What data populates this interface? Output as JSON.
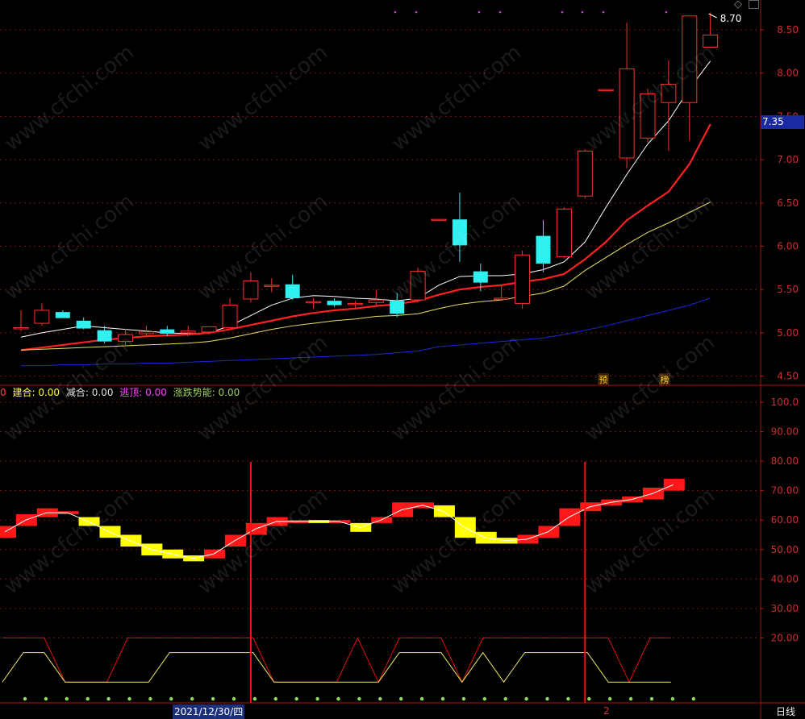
{
  "chart_data": [
    {
      "type": "candlestick",
      "period": "日线",
      "ylim": [
        4.45,
        8.75
      ],
      "y_ticks": [
        "8.50",
        "8.00",
        "7.50",
        "7.00",
        "6.50",
        "6.00",
        "5.50",
        "5.00",
        "4.50"
      ],
      "current_price": "7.35",
      "high_label": "8.70",
      "annotations": [
        "预",
        "榜"
      ],
      "candles": [
        {
          "o": 5.06,
          "h": 5.26,
          "l": 5.02,
          "c": 5.06
        },
        {
          "o": 5.11,
          "h": 5.34,
          "l": 5.08,
          "c": 5.26
        },
        {
          "o": 5.24,
          "h": 5.26,
          "l": 5.18,
          "c": 5.17
        },
        {
          "o": 5.14,
          "h": 5.18,
          "l": 5.04,
          "c": 5.05
        },
        {
          "o": 5.03,
          "h": 5.08,
          "l": 4.88,
          "c": 4.9
        },
        {
          "o": 4.9,
          "h": 5.05,
          "l": 4.86,
          "c": 4.98
        },
        {
          "o": 4.99,
          "h": 5.08,
          "l": 4.95,
          "c": 5.01
        },
        {
          "o": 5.04,
          "h": 5.08,
          "l": 4.96,
          "c": 4.99
        },
        {
          "o": 5.0,
          "h": 5.08,
          "l": 4.96,
          "c": 5.02
        },
        {
          "o": 5.01,
          "h": 5.07,
          "l": 4.98,
          "c": 5.07
        },
        {
          "o": 5.06,
          "h": 5.4,
          "l": 5.05,
          "c": 5.32
        },
        {
          "o": 5.39,
          "h": 5.7,
          "l": 5.35,
          "c": 5.6
        },
        {
          "o": 5.55,
          "h": 5.63,
          "l": 5.47,
          "c": 5.55
        },
        {
          "o": 5.56,
          "h": 5.67,
          "l": 5.38,
          "c": 5.4
        },
        {
          "o": 5.36,
          "h": 5.4,
          "l": 5.28,
          "c": 5.36
        },
        {
          "o": 5.37,
          "h": 5.4,
          "l": 5.3,
          "c": 5.32
        },
        {
          "o": 5.33,
          "h": 5.37,
          "l": 5.28,
          "c": 5.34
        },
        {
          "o": 5.35,
          "h": 5.5,
          "l": 5.32,
          "c": 5.38
        },
        {
          "o": 5.37,
          "h": 5.46,
          "l": 5.18,
          "c": 5.22
        },
        {
          "o": 5.38,
          "h": 5.75,
          "l": 5.35,
          "c": 5.71
        },
        {
          "o": 6.31,
          "h": 6.31,
          "l": 6.31,
          "c": 6.31
        },
        {
          "o": 6.31,
          "h": 6.62,
          "l": 5.82,
          "c": 6.01
        },
        {
          "o": 5.71,
          "h": 5.8,
          "l": 5.48,
          "c": 5.58
        },
        {
          "o": 5.39,
          "h": 5.55,
          "l": 5.37,
          "c": 5.4
        },
        {
          "o": 5.34,
          "h": 5.95,
          "l": 5.28,
          "c": 5.9
        },
        {
          "o": 6.12,
          "h": 6.3,
          "l": 5.7,
          "c": 5.8
        },
        {
          "o": 5.88,
          "h": 6.45,
          "l": 5.86,
          "c": 6.43
        },
        {
          "o": 6.58,
          "h": 7.12,
          "l": 6.55,
          "c": 7.1
        },
        {
          "o": 7.81,
          "h": 7.81,
          "l": 7.81,
          "c": 7.81
        },
        {
          "o": 7.02,
          "h": 8.58,
          "l": 6.9,
          "c": 8.05
        },
        {
          "o": 7.25,
          "h": 7.82,
          "l": 7.2,
          "c": 7.76
        },
        {
          "o": 7.66,
          "h": 8.15,
          "l": 7.1,
          "c": 7.87
        },
        {
          "o": 7.66,
          "h": 8.65,
          "l": 7.22,
          "c": 8.66
        },
        {
          "o": 8.3,
          "h": 8.7,
          "l": 8.3,
          "c": 8.44
        }
      ],
      "series": [
        {
          "color": "#ffffff",
          "values": [
            4.95,
            5.0,
            5.04,
            5.08,
            5.06,
            5.04,
            5.02,
            5.0,
            4.99,
            5.0,
            5.08,
            5.2,
            5.32,
            5.4,
            5.43,
            5.42,
            5.4,
            5.39,
            5.37,
            5.4,
            5.55,
            5.65,
            5.66,
            5.66,
            5.68,
            5.73,
            5.82,
            6.05,
            6.45,
            6.83,
            7.18,
            7.45,
            7.82,
            8.14
          ]
        },
        {
          "color": "#ff2020",
          "values": [
            4.8,
            4.83,
            4.86,
            4.89,
            4.92,
            4.94,
            4.96,
            4.97,
            4.98,
            5.0,
            5.04,
            5.09,
            5.14,
            5.19,
            5.23,
            5.26,
            5.28,
            5.31,
            5.33,
            5.37,
            5.44,
            5.5,
            5.53,
            5.55,
            5.59,
            5.62,
            5.68,
            5.85,
            6.05,
            6.3,
            6.47,
            6.63,
            6.95,
            7.41
          ]
        },
        {
          "color": "#e8e060",
          "values": [
            4.8,
            4.81,
            4.82,
            4.83,
            4.84,
            4.85,
            4.86,
            4.87,
            4.88,
            4.9,
            4.94,
            4.99,
            5.04,
            5.08,
            5.11,
            5.14,
            5.16,
            5.19,
            5.2,
            5.22,
            5.28,
            5.33,
            5.36,
            5.38,
            5.42,
            5.46,
            5.54,
            5.72,
            5.87,
            6.02,
            6.16,
            6.27,
            6.39,
            6.51
          ]
        },
        {
          "color": "#1a2ad8",
          "values": [
            4.62,
            4.62,
            4.63,
            4.63,
            4.64,
            4.64,
            4.65,
            4.65,
            4.66,
            4.67,
            4.68,
            4.69,
            4.7,
            4.71,
            4.72,
            4.73,
            4.74,
            4.75,
            4.77,
            4.79,
            4.84,
            4.86,
            4.88,
            4.9,
            4.92,
            4.94,
            4.98,
            5.03,
            5.08,
            5.14,
            5.2,
            5.26,
            5.32,
            5.4
          ]
        }
      ]
    },
    {
      "type": "indicator",
      "ylim": [
        0,
        105
      ],
      "y_ticks": [
        "100.0",
        "90.00",
        "80.00",
        "70.00",
        "60.00",
        "50.00",
        "40.00",
        "30.00",
        "20.00"
      ],
      "legend": [
        {
          "label": "0",
          "color": "#ff4040"
        },
        {
          "label": "建合: 0.00",
          "color": "#ffff40"
        },
        {
          "label": "减合: 0.00",
          "color": "#e0e0e0"
        },
        {
          "label": "逃顶: 0.00",
          "color": "#ff40ff"
        },
        {
          "label": "涨跌势能: 0.00",
          "color": "#a0d060"
        }
      ],
      "bars": [
        {
          "a": 54,
          "b": 58,
          "color": "red"
        },
        {
          "a": 58,
          "b": 62,
          "color": "red"
        },
        {
          "a": 61,
          "b": 64,
          "color": "red"
        },
        {
          "a": 62,
          "b": 63,
          "color": "red"
        },
        {
          "a": 58,
          "b": 61,
          "color": "yellow"
        },
        {
          "a": 54,
          "b": 58,
          "color": "yellow"
        },
        {
          "a": 51,
          "b": 55,
          "color": "yellow"
        },
        {
          "a": 48,
          "b": 52,
          "color": "yellow"
        },
        {
          "a": 47,
          "b": 50,
          "color": "yellow"
        },
        {
          "a": 46,
          "b": 48,
          "color": "yellow"
        },
        {
          "a": 47,
          "b": 50,
          "color": "red"
        },
        {
          "a": 51,
          "b": 55,
          "color": "red"
        },
        {
          "a": 55,
          "b": 59,
          "color": "red"
        },
        {
          "a": 58,
          "b": 61,
          "color": "red"
        },
        {
          "a": 59,
          "b": 60,
          "color": "red"
        },
        {
          "a": 59,
          "b": 60,
          "color": "yellow"
        },
        {
          "a": 59,
          "b": 60,
          "color": "red"
        },
        {
          "a": 56,
          "b": 59,
          "color": "yellow"
        },
        {
          "a": 59,
          "b": 61,
          "color": "red"
        },
        {
          "a": 61,
          "b": 66,
          "color": "red"
        },
        {
          "a": 64,
          "b": 66,
          "color": "red"
        },
        {
          "a": 61,
          "b": 65,
          "color": "yellow"
        },
        {
          "a": 54,
          "b": 61,
          "color": "yellow"
        },
        {
          "a": 52,
          "b": 56,
          "color": "yellow"
        },
        {
          "a": 52,
          "b": 54,
          "color": "yellow"
        },
        {
          "a": 52,
          "b": 55,
          "color": "red"
        },
        {
          "a": 54,
          "b": 58,
          "color": "red"
        },
        {
          "a": 58,
          "b": 64,
          "color": "red"
        },
        {
          "a": 63,
          "b": 66,
          "color": "red"
        },
        {
          "a": 65,
          "b": 67,
          "color": "red"
        },
        {
          "a": 66,
          "b": 68,
          "color": "red"
        },
        {
          "a": 67,
          "b": 71,
          "color": "red"
        },
        {
          "a": 70,
          "b": 74,
          "color": "red"
        }
      ],
      "red_line": [
        20,
        20,
        20,
        5,
        5,
        5,
        20,
        20,
        20,
        20,
        20,
        20,
        20,
        5,
        5,
        5,
        5,
        20,
        5,
        20,
        20,
        20,
        5,
        20,
        20,
        20,
        20,
        20,
        20,
        20,
        5,
        20,
        20
      ],
      "yellow_line": [
        5,
        15,
        15,
        5,
        5,
        5,
        5,
        5,
        15,
        15,
        15,
        15,
        15,
        5,
        5,
        5,
        5,
        5,
        5,
        15,
        15,
        15,
        5,
        15,
        5,
        15,
        15,
        15,
        15,
        5,
        5,
        5,
        5
      ],
      "signal_lines_at": [
        11,
        27
      ]
    }
  ],
  "date_label": "2021/12/30/四",
  "footer_marker": "2",
  "period_label": "日线",
  "watermark": "www.cfchi.com"
}
